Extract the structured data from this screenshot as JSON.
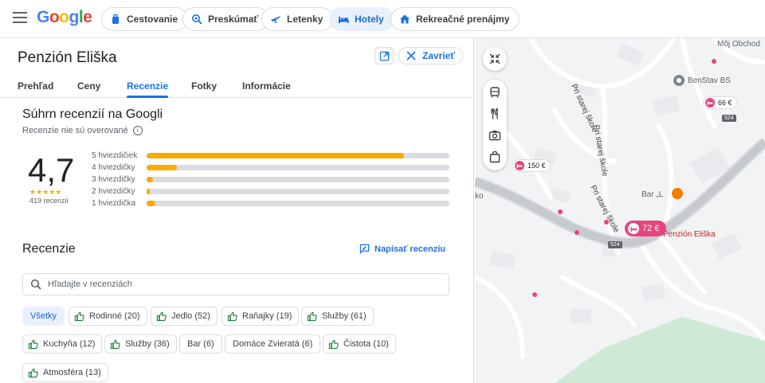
{
  "header": {
    "logo_letters": [
      "G",
      "o",
      "o",
      "g",
      "l",
      "e"
    ],
    "nav": [
      {
        "label": "Cestovanie",
        "icon": "suitcase-icon"
      },
      {
        "label": "Preskúmať",
        "icon": "explore-search-icon"
      },
      {
        "label": "Letenky",
        "icon": "airplane-icon"
      },
      {
        "label": "Hotely",
        "icon": "bed-icon",
        "active": true
      },
      {
        "label": "Rekreačné prenájmy",
        "icon": "house-icon"
      }
    ]
  },
  "place": {
    "name": "Penzión Eliška",
    "close_label": "Zavrieť",
    "tabs": [
      "Prehľad",
      "Ceny",
      "Recenzie",
      "Fotky",
      "Informácie"
    ],
    "active_tab": "Recenzie"
  },
  "summary": {
    "title": "Súhrn recenzií na Googli",
    "unverified": "Recenzie nie sú overované",
    "rating": "4,7",
    "stars": "★★★★★",
    "review_count": "419 recenzií",
    "distribution": [
      {
        "label": "5 hviezdičiek",
        "fraction": 0.85
      },
      {
        "label": "4 hviezdičky",
        "fraction": 0.1
      },
      {
        "label": "3 hviezdičky",
        "fraction": 0.02
      },
      {
        "label": "2 hviezdičky",
        "fraction": 0.01
      },
      {
        "label": "1 hviezdička",
        "fraction": 0.03
      }
    ]
  },
  "reviews": {
    "title": "Recenzie",
    "write_label": "Napísať recenziu",
    "search_placeholder": "Hľadajte v recenziách",
    "filters": [
      {
        "label": "Všetky",
        "active": true
      },
      {
        "label": "Rodinné (20)"
      },
      {
        "label": "Jedlo (52)"
      },
      {
        "label": "Raňajky (19)"
      },
      {
        "label": "Služby (61)"
      },
      {
        "label": "Kuchyňa (12)"
      },
      {
        "label": "Služby (36)"
      },
      {
        "label": "Bar (6)",
        "no_icon": true
      },
      {
        "label": "Domáce Zvieratá (6)",
        "no_icon": true
      },
      {
        "label": "Čistota (10)"
      },
      {
        "label": "Atmosféra (13)"
      }
    ]
  },
  "map": {
    "poi_labels": [
      "Môj Obchod",
      "BenStav BS",
      "Bar „L",
      "Penzión Eliška",
      "ko"
    ],
    "streets": [
      "Pri starej škole",
      "Pri starej škole",
      "Pri starej škole"
    ],
    "road_number": "524",
    "prices": [
      "66 €",
      "150 €",
      "72 €"
    ]
  },
  "colors": {
    "accent": "#1a73e8",
    "star": "#f9ab00",
    "hotel_pin": "#e8457c"
  }
}
